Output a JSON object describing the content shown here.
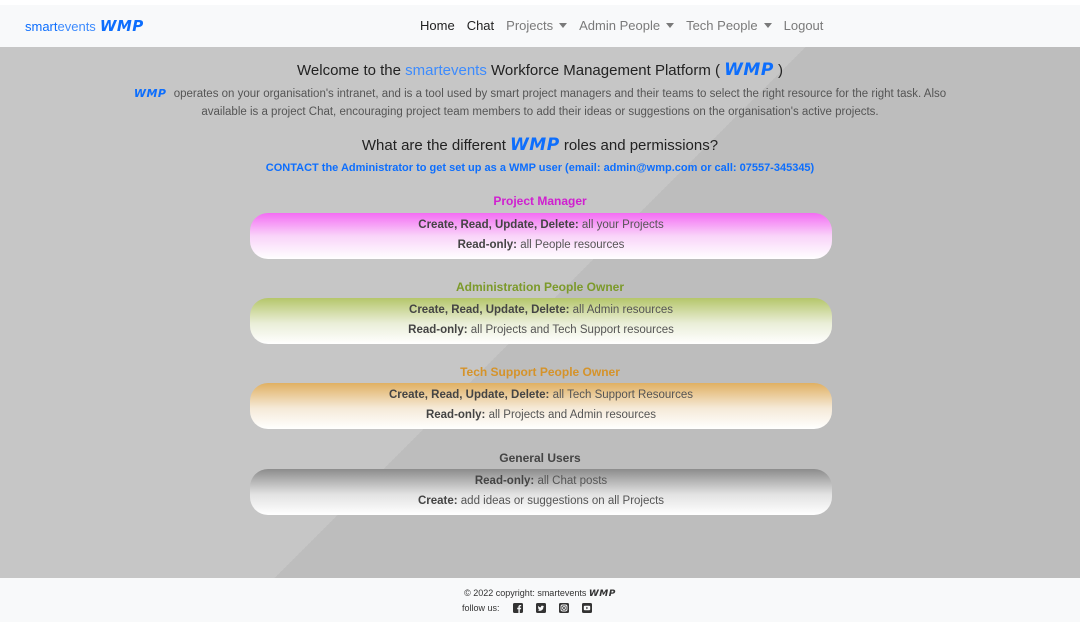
{
  "nav": {
    "brand_smart": "smart",
    "brand_events": "events",
    "brand_wmp": "WMP",
    "links": [
      {
        "label": "Home",
        "dropdown": false,
        "active": true
      },
      {
        "label": "Chat",
        "dropdown": false,
        "active": true
      },
      {
        "label": "Projects",
        "dropdown": true
      },
      {
        "label": "Admin People",
        "dropdown": true
      },
      {
        "label": "Tech People",
        "dropdown": true
      },
      {
        "label": "Logout",
        "dropdown": false
      }
    ]
  },
  "welcome": {
    "prefix": "Welcome to the ",
    "smart": "smart",
    "events": "events",
    "middle": " Workforce Management Platform ( ",
    "wmp": "WMP",
    "suffix": " )"
  },
  "intro": {
    "wmp": "WMP",
    "text": "operates on your organisation's intranet, and is a tool used by smart project managers and their teams to select the right resource for the right task. Also available is a project Chat, encouraging project team members to add their ideas or suggestions on the organisation's active projects."
  },
  "roles_heading": {
    "prefix": "What are the different ",
    "wmp": "WMP",
    "suffix": " roles and permissions?"
  },
  "contact": "CONTACT the Administrator to get set up as a WMP user (email: admin@wmp.com or call: 07557-345345)",
  "roles": [
    {
      "title": "Project Manager",
      "line1_bold": "Create, Read, Update, Delete:",
      "line1_text": " all your Projects",
      "line2_bold": "Read-only:",
      "line2_text": " all People resources"
    },
    {
      "title": "Administration People Owner",
      "line1_bold": "Create, Read, Update, Delete:",
      "line1_text": " all Admin resources",
      "line2_bold": "Read-only:",
      "line2_text": " all Projects and Tech Support resources"
    },
    {
      "title": "Tech Support People Owner",
      "line1_bold": "Create, Read, Update, Delete:",
      "line1_text": " all Tech Support Resources",
      "line2_bold": "Read-only:",
      "line2_text": " all Projects and Admin resources"
    },
    {
      "title": "General Users",
      "line1_bold": "Read-only:",
      "line1_text": " all Chat posts",
      "line2_bold": "Create:",
      "line2_text": " add ideas or suggestions on all Projects"
    }
  ],
  "footer": {
    "copyright": "© 2022 copyright: smartevents",
    "wmp": "WMP",
    "follow": "follow us:",
    "social_icons": [
      "facebook-icon",
      "twitter-icon",
      "instagram-icon",
      "youtube-icon"
    ]
  },
  "colors": {
    "brand_blue": "#0d6efd",
    "project_manager": "#d01fd0",
    "admin_owner": "#7c9a2a",
    "tech_owner": "#d5932a",
    "general_users": "#444444"
  }
}
